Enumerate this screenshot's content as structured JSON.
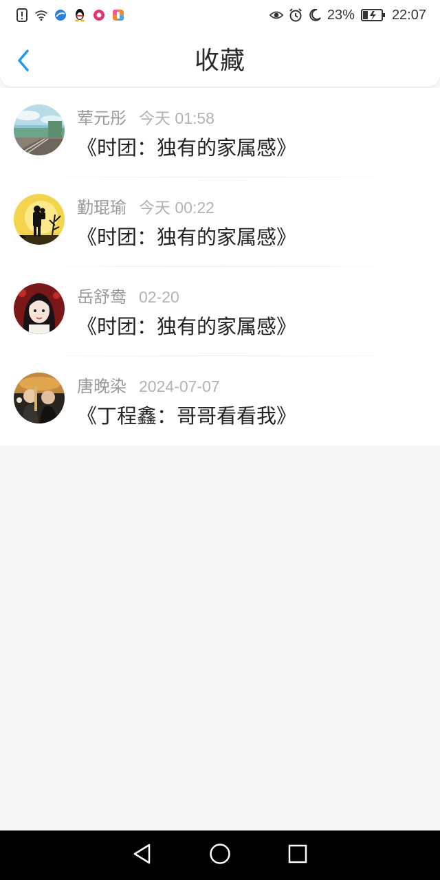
{
  "status_bar": {
    "battery_percent": "23%",
    "time": "22:07",
    "left_icons": [
      "alert-icon",
      "wifi-icon",
      "browser-icon",
      "qq-icon",
      "chat-app-icon",
      "app-icon"
    ],
    "right_icons": [
      "eye-icon",
      "alarm-icon",
      "moon-icon",
      "battery-charging-icon"
    ]
  },
  "header": {
    "title": "收藏",
    "back_icon": "chevron-left-icon",
    "accent_color": "#2196f3"
  },
  "favorites": [
    {
      "user": "荤元彤",
      "time": "今天 01:58",
      "title": "《时团：独有的家属感》",
      "avatar": "landscape-rail-avatar"
    },
    {
      "user": "勤琨瑜",
      "time": "今天 00:22",
      "title": "《时团：独有的家属感》",
      "avatar": "silhouette-sunset-avatar"
    },
    {
      "user": "岳舒鸯",
      "time": "02-20",
      "title": "《时团：独有的家属感》",
      "avatar": "girl-portrait-avatar"
    },
    {
      "user": "唐晚染",
      "time": "2024-07-07",
      "title": "《丁程鑫：哥哥看看我》",
      "avatar": "group-photo-avatar"
    }
  ],
  "nav": {
    "back": "triangle-back-icon",
    "home": "circle-home-icon",
    "recents": "square-recents-icon"
  }
}
